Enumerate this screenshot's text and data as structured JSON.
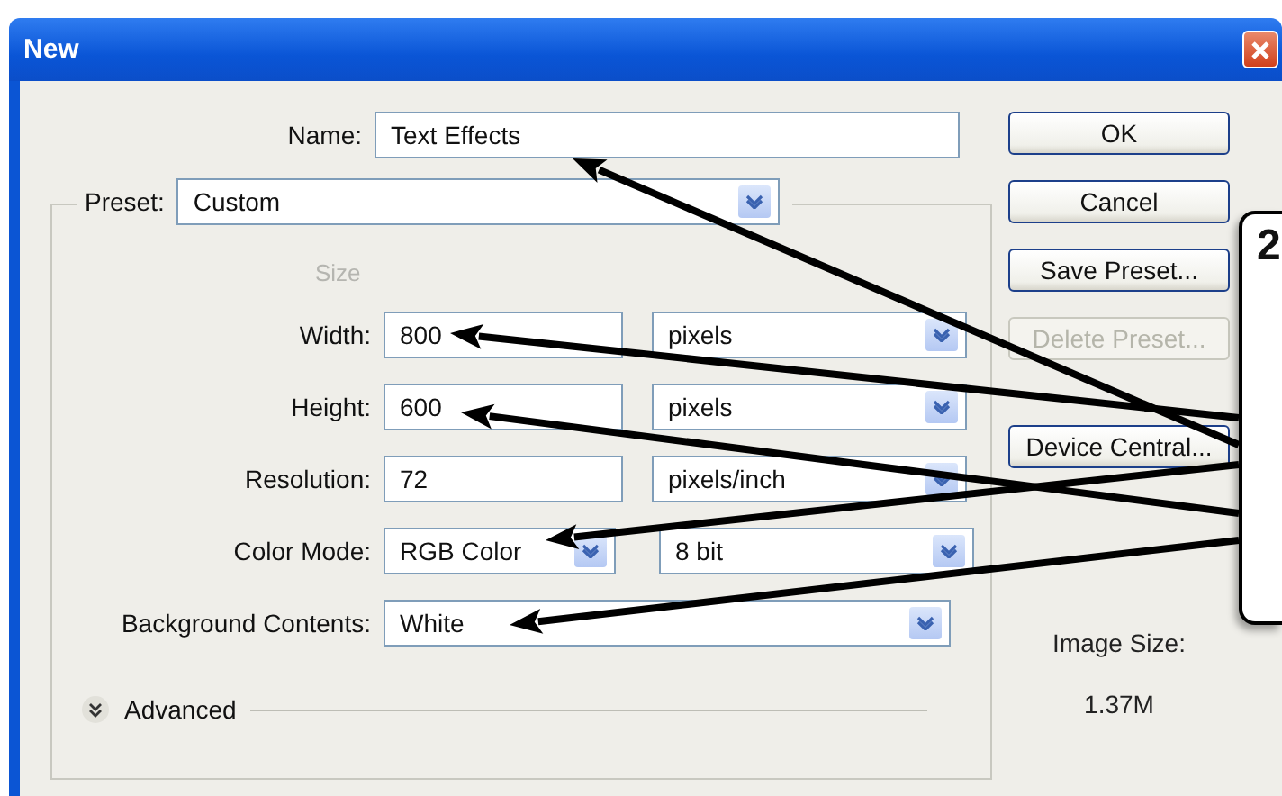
{
  "window": {
    "title": "New"
  },
  "name": {
    "label": "Name:",
    "value": "Text Effects"
  },
  "preset": {
    "label": "Preset:",
    "value": "Custom"
  },
  "size_group": {
    "label": "Size",
    "disabled": true
  },
  "fields": [
    {
      "kind": "input",
      "label": "Width:",
      "value": "800",
      "unit": "pixels"
    },
    {
      "kind": "input",
      "label": "Height:",
      "value": "600",
      "unit": "pixels"
    },
    {
      "kind": "input",
      "label": "Resolution:",
      "value": "72",
      "unit": "pixels/inch"
    },
    {
      "kind": "select",
      "label": "Color Mode:",
      "value": "RGB Color",
      "unit": "8 bit"
    },
    {
      "kind": "select-wide",
      "label": "Background Contents:",
      "value": "White"
    }
  ],
  "advanced": {
    "label": "Advanced",
    "expanded": false
  },
  "buttons": [
    {
      "label": "OK",
      "disabled": false
    },
    {
      "label": "Cancel",
      "disabled": false
    },
    {
      "label": "Save Preset...",
      "disabled": false
    },
    {
      "label": "Delete Preset...",
      "disabled": true
    },
    {
      "label": "Device Central...",
      "disabled": false
    }
  ],
  "image_size": {
    "label": "Image Size:",
    "value": "1.37M"
  },
  "callout": {
    "text": "2"
  }
}
